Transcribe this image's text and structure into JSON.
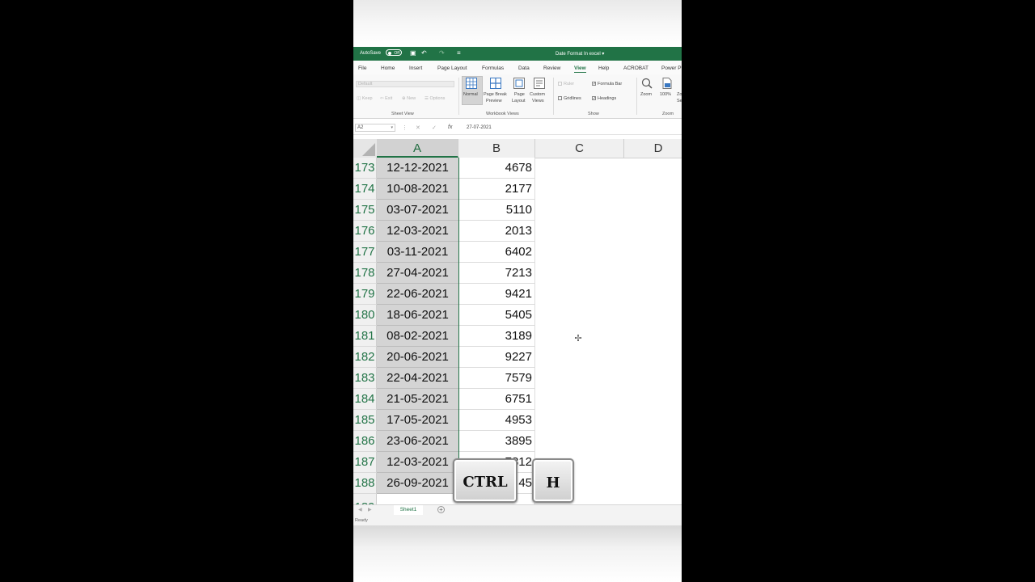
{
  "title_bar": {
    "autosave_label": "AutoSave",
    "autosave_state": "Off",
    "document_title": "Date Format In excel ▾"
  },
  "ribbon": {
    "tabs": [
      {
        "label": "File",
        "active": false
      },
      {
        "label": "Home",
        "active": false
      },
      {
        "label": "Insert",
        "active": false
      },
      {
        "label": "Page Layout",
        "active": false
      },
      {
        "label": "Formulas",
        "active": false
      },
      {
        "label": "Data",
        "active": false
      },
      {
        "label": "Review",
        "active": false
      },
      {
        "label": "View",
        "active": true
      },
      {
        "label": "Help",
        "active": false
      },
      {
        "label": "ACROBAT",
        "active": false
      },
      {
        "label": "Power P",
        "active": false
      }
    ],
    "sheet_view": {
      "dropdown_value": "Default",
      "keep": "Keep",
      "exit": "Exit",
      "new": "New",
      "options": "Options",
      "group_label": "Sheet View"
    },
    "workbook_views": {
      "normal": "Normal",
      "page_break_1": "Page Break",
      "page_break_2": "Preview",
      "page_layout_1": "Page",
      "page_layout_2": "Layout",
      "custom_1": "Custom",
      "custom_2": "Views",
      "group_label": "Workbook Views"
    },
    "show": {
      "ruler": "Ruler",
      "formula_bar": "Formula Bar",
      "gridlines": "Gridlines",
      "headings": "Headings",
      "group_label": "Show"
    },
    "zoom": {
      "zoom": "Zoom",
      "hundred": "100%",
      "zoom_to": "Zo",
      "zoom_to_2": "Se",
      "group_label": "Zoom"
    }
  },
  "formula_bar": {
    "name_box": "A2",
    "value": "27-07-2021"
  },
  "grid": {
    "columns": [
      "A",
      "B",
      "C",
      "D"
    ],
    "rows": [
      {
        "row": "173",
        "date": "12-12-2021",
        "value": "4678"
      },
      {
        "row": "174",
        "date": "10-08-2021",
        "value": "2177"
      },
      {
        "row": "175",
        "date": "03-07-2021",
        "value": "5110"
      },
      {
        "row": "176",
        "date": "12-03-2021",
        "value": "2013"
      },
      {
        "row": "177",
        "date": "03-11-2021",
        "value": "6402"
      },
      {
        "row": "178",
        "date": "27-04-2021",
        "value": "7213"
      },
      {
        "row": "179",
        "date": "22-06-2021",
        "value": "9421"
      },
      {
        "row": "180",
        "date": "18-06-2021",
        "value": "5405"
      },
      {
        "row": "181",
        "date": "08-02-2021",
        "value": "3189"
      },
      {
        "row": "182",
        "date": "20-06-2021",
        "value": "9227"
      },
      {
        "row": "183",
        "date": "22-04-2021",
        "value": "7579"
      },
      {
        "row": "184",
        "date": "21-05-2021",
        "value": "6751"
      },
      {
        "row": "185",
        "date": "17-05-2021",
        "value": "4953"
      },
      {
        "row": "186",
        "date": "23-06-2021",
        "value": "3895"
      },
      {
        "row": "187",
        "date": "12-03-2021",
        "value": "7812"
      },
      {
        "row": "188",
        "date": "26-09-2021",
        "value": "45"
      },
      {
        "row": "189",
        "date": "",
        "value": ""
      }
    ]
  },
  "keys": {
    "ctrl": "CTRL",
    "h": "H"
  },
  "sheet_tabs": {
    "active": "Sheet1"
  },
  "status": {
    "text": "Ready"
  }
}
